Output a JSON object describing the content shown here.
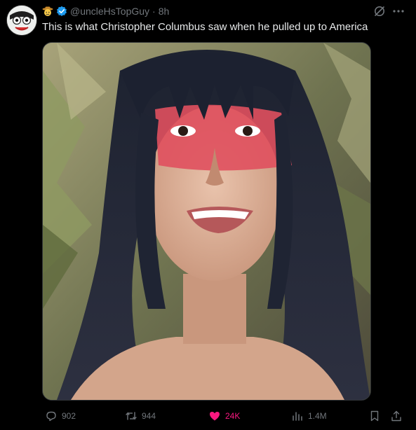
{
  "tweet": {
    "handle": "@uncleHsTopGuy",
    "separator": "·",
    "time": "8h",
    "text": "This is what Christopher Columbus saw when he pulled up to America"
  },
  "actions": {
    "replies": "902",
    "reposts": "944",
    "likes": "24K",
    "views": "1.4M"
  },
  "colors": {
    "background": "#000000",
    "text": "#e7e9ea",
    "muted": "#71767b",
    "verified": "#1d9bf0",
    "like": "#f91880"
  },
  "icons": {
    "reply": "reply-icon",
    "repost": "repost-icon",
    "like": "heart-icon",
    "views": "views-icon",
    "bookmark": "bookmark-icon",
    "share": "share-icon",
    "more": "more-icon",
    "grok": "grok-icon",
    "verified": "verified-badge-icon"
  }
}
